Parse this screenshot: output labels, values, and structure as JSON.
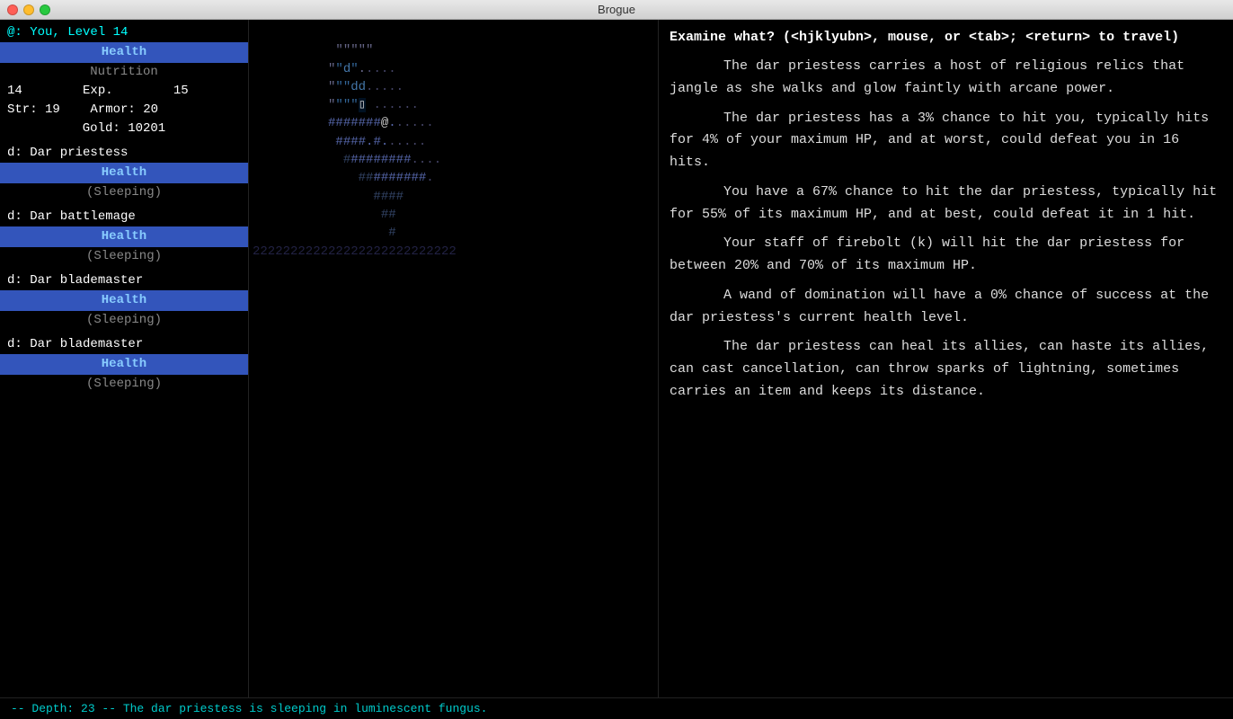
{
  "titlebar": {
    "title": "Brogue"
  },
  "sidebar": {
    "player_label": "@: You, Level 14",
    "health_label": "Health",
    "nutrition_label": "Nutrition",
    "level_label": "14",
    "exp_label": "Exp.",
    "exp_value": "15",
    "str_label": "Str: 19",
    "armor_label": "Armor: 20",
    "gold_label": "Gold: 10201",
    "entities": [
      {
        "name": "d: Dar priestess",
        "health": "Health",
        "status": "(Sleeping)",
        "highlighted": true
      },
      {
        "name": "d: Dar battlemage",
        "health": "Health",
        "status": "(Sleeping)",
        "highlighted": false
      },
      {
        "name": "d: Dar blademaster",
        "health": "Health",
        "status": "(Sleeping)",
        "highlighted": false
      },
      {
        "name": "d: Dar blademaster",
        "health": "Health",
        "status": "(Sleeping)",
        "highlighted": false
      }
    ]
  },
  "infopanel": {
    "examine_prompt": "Examine what? (<hjklyubn>, mouse, or <tab>; <return> to travel)",
    "description": "The dar priestess carries a host of religious relics that jangle as she walks and glow faintly with arcane power.\n     The dar priestess has a 3% chance to hit you, typically hits for 4% of your maximum HP, and at worst, could defeat you in 16 hits.\n     You have a 67% chance to hit the dar priestess, typically hit for 55% of its maximum HP, and at best, could defeat it in 1 hit.\n     Your staff of firebolt (k) will hit the dar priestess for between 20% and 70% of its maximum HP.\n     A wand of domination will have a 0% chance of success at the dar priestess's current health level.\n     The dar priestess can heal its allies, can haste its allies, can cast cancellation, can throw sparks of lightning, sometimes carries an item and keeps its distance."
  },
  "statusbar": {
    "text": "-- Depth: 23 --    The dar priestess is sleeping in luminescent fungus."
  },
  "colors": {
    "health_bar_bg": "#3355bb",
    "health_bar_text": "#88ccff",
    "accent_cyan": "#00cccc",
    "white": "#ffffff",
    "gray": "#888888"
  }
}
